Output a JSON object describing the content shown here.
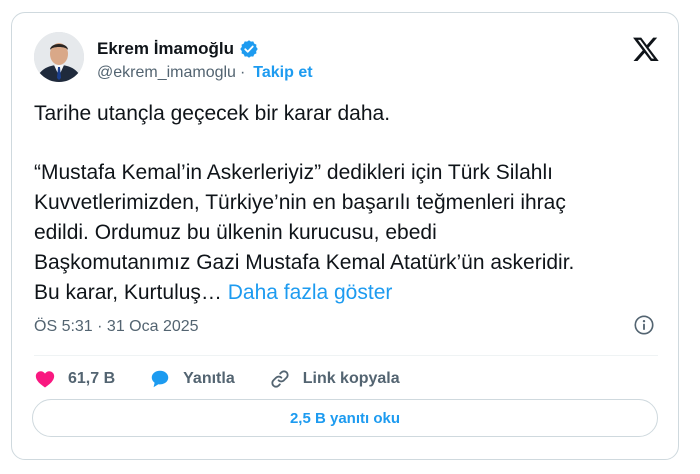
{
  "author": {
    "name": "Ekrem İmamoğlu",
    "handle": "@ekrem_imamoglu",
    "separator": "·",
    "follow_label": "Takip et",
    "verified_color": "#1d9bf0"
  },
  "tweet": {
    "paragraph1": "Tarihe utançla geçecek bir karar daha.",
    "paragraph2": "“Mustafa Kemal’in Askerleriyiz” dedikleri için Türk Silahlı\nKuvvetlerimizden, Türkiye’nin en başarılı teğmenleri ihraç\nedildi. Ordumuz bu ülkenin kurucusu, ebedi\nBaşkomutanımız Gazi Mustafa Kemal Atatürk’ün askeridir.\nBu karar, Kurtuluş…",
    "show_more_label": "Daha fazla göster",
    "timestamp": "ÖS 5:31 · 31 Oca 2025"
  },
  "actions": {
    "likes": "61,7 B",
    "reply_label": "Yanıtla",
    "copy_link_label": "Link kopyala",
    "like_color": "#f91880",
    "reply_color": "#1d9bf0"
  },
  "read_replies_label": "2,5 B yanıtı oku",
  "icons": [
    "avatar",
    "verified-badge-icon",
    "x-logo-icon",
    "info-icon",
    "heart-icon",
    "reply-bubble-icon",
    "link-icon"
  ]
}
